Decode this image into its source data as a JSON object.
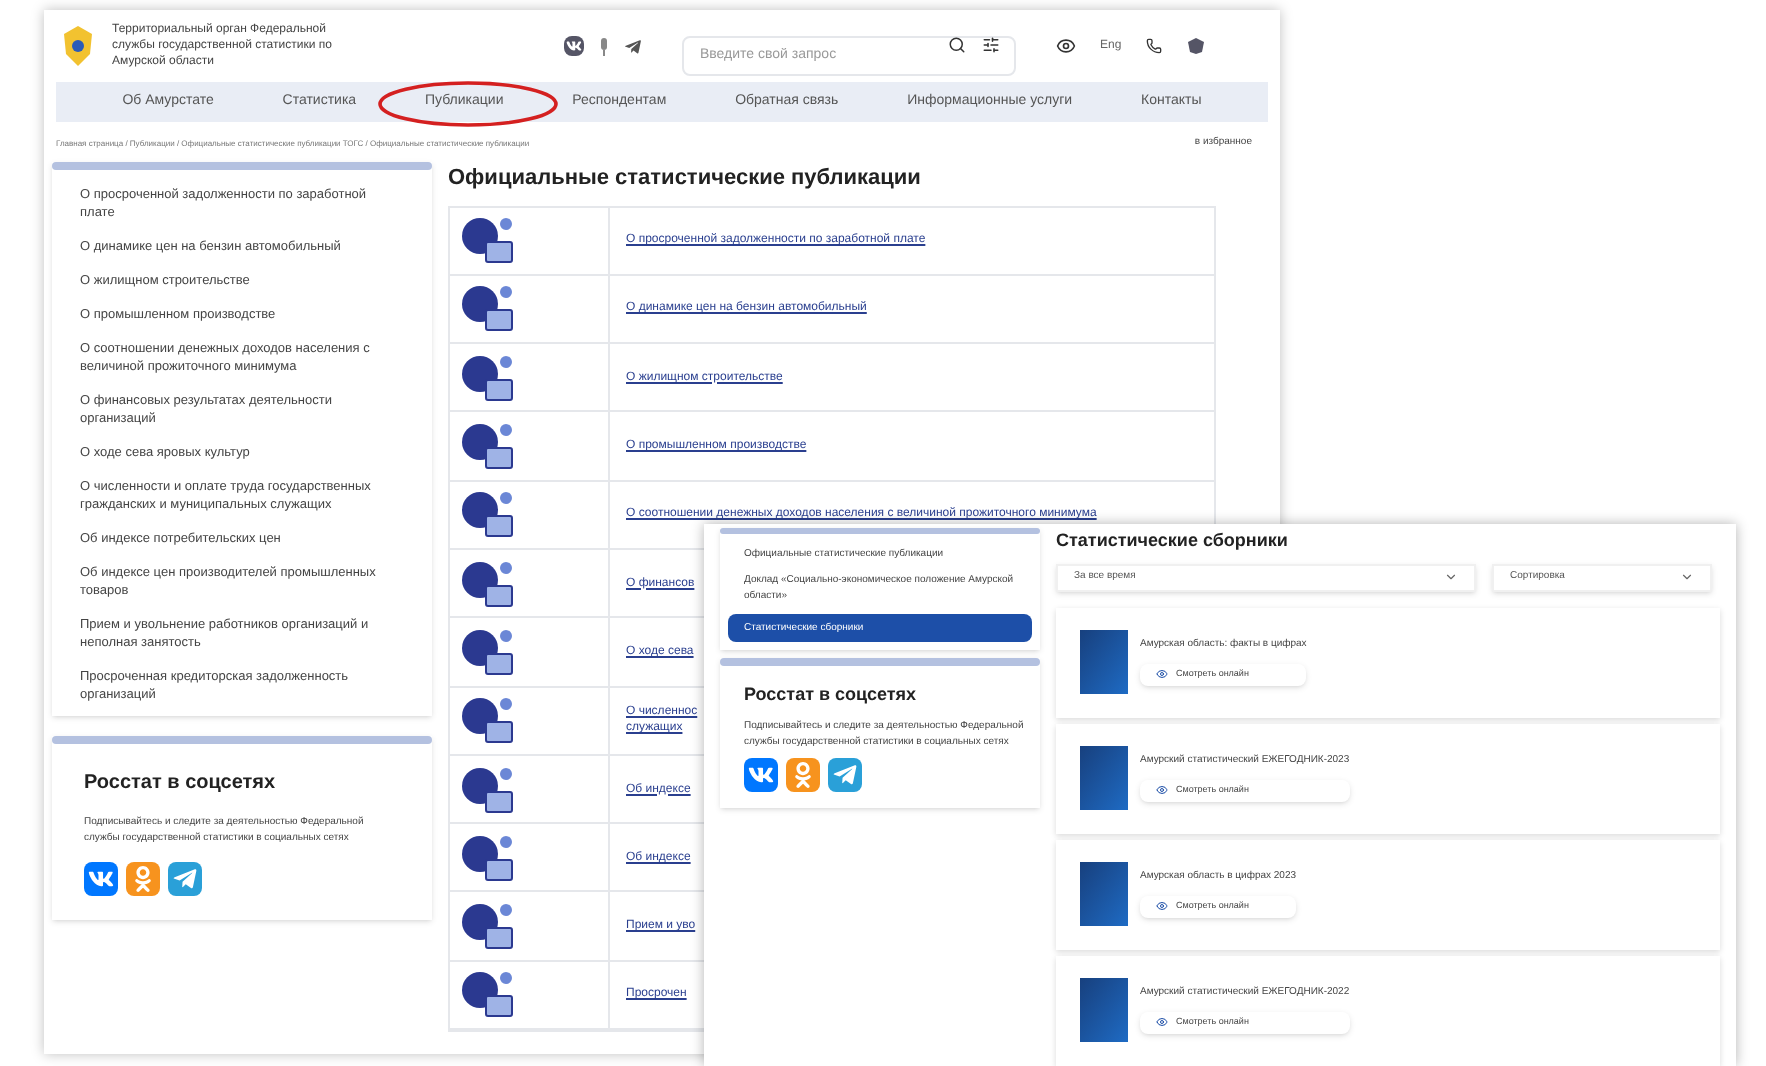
{
  "header": {
    "org_name": "Территориальный орган Федеральной службы государственной статистики по Амурской области",
    "search": {
      "placeholder": "Введите свой запрос"
    },
    "language": "Eng"
  },
  "nav": [
    {
      "label": "Об Амурстате",
      "circled": false
    },
    {
      "label": "Статистика",
      "circled": false
    },
    {
      "label": "Публикации",
      "circled": true
    },
    {
      "label": "Респондентам",
      "circled": false
    },
    {
      "label": "Обратная связь",
      "circled": false
    },
    {
      "label": "Информационные услуги",
      "circled": false
    },
    {
      "label": "Контакты",
      "circled": false
    }
  ],
  "breadcrumb": "Главная страница / Публикации / Официальные статистические публикации ТОГС / Официальные статистические публикации",
  "favorites": "в избранное",
  "sidebar": [
    "О просроченной задолженности по заработной плате",
    "О динамике цен на бензин автомобильный",
    "О жилищном строительстве",
    "О промышленном производстве",
    "О соотношении денежных доходов населения с величиной прожиточного минимума",
    "О финансовых результатах деятельности организаций",
    "О ходе сева яровых культур",
    "О численности и оплате труда государственных гражданских и муниципальных служащих",
    "Об индексе потребительских цен",
    "Об индексе цен производителей промышленных товаров",
    "Прием и увольнение работников организаций и неполная занятость",
    "Просроченная кредиторская задолженность организаций"
  ],
  "social": {
    "title": "Росстат в соцсетях",
    "text": "Подписывайтесь и следите за деятельностью Федеральной службы государственной статистики в социальных сетях"
  },
  "main": {
    "title": "Официальные статистические публикации",
    "rows": [
      "О просроченной задолженности по заработной плате",
      "О динамике цен на бензин автомобильный",
      "О жилищном строительстве",
      "О промышленном производстве",
      "О соотношении денежных доходов населения с величиной прожиточного минимума",
      "О финансов",
      "О ходе сева",
      "О численнос\nслужащих",
      "Об индексе",
      "Об индексе",
      "Прием и уво",
      "Просрочен"
    ]
  },
  "overlay": {
    "sidebar": [
      {
        "label": "Официальные статистические публикации",
        "selected": false
      },
      {
        "label": "Доклад «Социально-экономическое положение Амурской области»",
        "selected": false
      },
      {
        "label": "Статистические сборники",
        "selected": true
      }
    ],
    "social": {
      "title": "Росстат в соцсетях",
      "text": "Подписывайтесь и следите за деятельностью Федеральной службы государственной статистики в социальных сетях"
    },
    "title": "Статистические сборники",
    "filters": [
      "За все время",
      "Сортировка"
    ],
    "collections": [
      {
        "title": "Амурская область: факты в цифрах",
        "button": "Смотреть онлайн"
      },
      {
        "title": "Амурский статистический ЕЖЕГОДНИК-2023",
        "button": "Смотреть онлайн"
      },
      {
        "title": "Амурская область в цифрах 2023",
        "button": "Смотреть онлайн"
      },
      {
        "title": "Амурский статистический ЕЖЕГОДНИК-2022",
        "button": "Смотреть онлайн"
      }
    ]
  }
}
